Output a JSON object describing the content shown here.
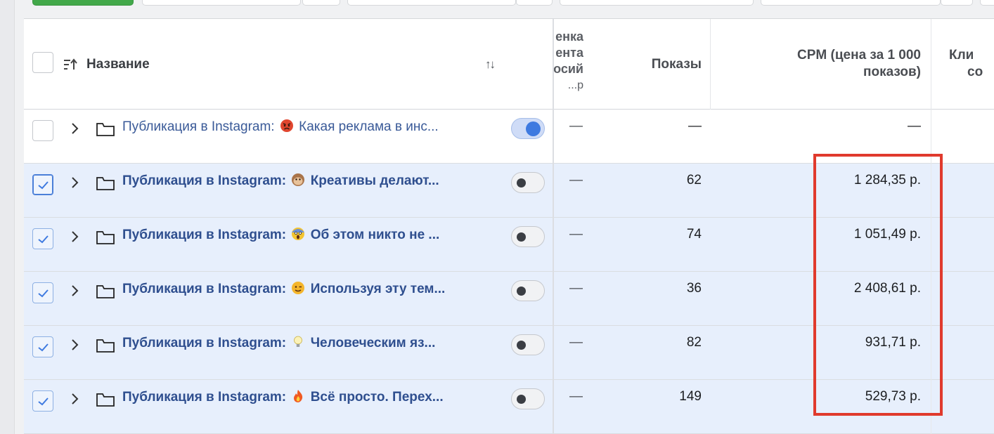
{
  "colors": {
    "accent": "#3e7ae0",
    "highlight": "#e03a2d",
    "selected_row": "#e7effc",
    "button_green": "#42a84a"
  },
  "header": {
    "name_label": "Название",
    "truncated_col": [
      "енка",
      "ента",
      "осий",
      "р..."
    ],
    "shows_label": "Показы",
    "cpm_label_1": "CPM (цена за 1 000",
    "cpm_label_2": "показов)",
    "clicks_label_1": "Кли",
    "clicks_label_2": "со"
  },
  "rows": [
    {
      "prefix": "Публикация в Instagram:",
      "emoji": "angry-face",
      "title": "Какая реклама в инс...",
      "selected": false,
      "toggle_on": true,
      "col_a": "—",
      "shows": "—",
      "cpm": "—"
    },
    {
      "prefix": "Публикация в Instagram:",
      "emoji": "monkey-face",
      "title": "Креативы делают...",
      "selected": true,
      "toggle_on": false,
      "col_a": "—",
      "shows": "62",
      "cpm": "1 284,35 р."
    },
    {
      "prefix": "Публикация в Instagram:",
      "emoji": "screaming-face",
      "title": "Об этом никто не ...",
      "selected": true,
      "toggle_on": false,
      "col_a": "—",
      "shows": "74",
      "cpm": "1 051,49 р."
    },
    {
      "prefix": "Публикация в Instagram:",
      "emoji": "winking-face",
      "title": "Используя эту тем...",
      "selected": true,
      "toggle_on": false,
      "col_a": "—",
      "shows": "36",
      "cpm": "2 408,61 р."
    },
    {
      "prefix": "Публикация в Instagram:",
      "emoji": "light-bulb",
      "title": "Человеческим яз...",
      "selected": true,
      "toggle_on": false,
      "col_a": "—",
      "shows": "82",
      "cpm": "931,71 р."
    },
    {
      "prefix": "Публикация в Instagram:",
      "emoji": "fire",
      "title": "Всё просто. Перех...",
      "selected": true,
      "toggle_on": false,
      "col_a": "—",
      "shows": "149",
      "cpm": "529,73 р."
    }
  ]
}
